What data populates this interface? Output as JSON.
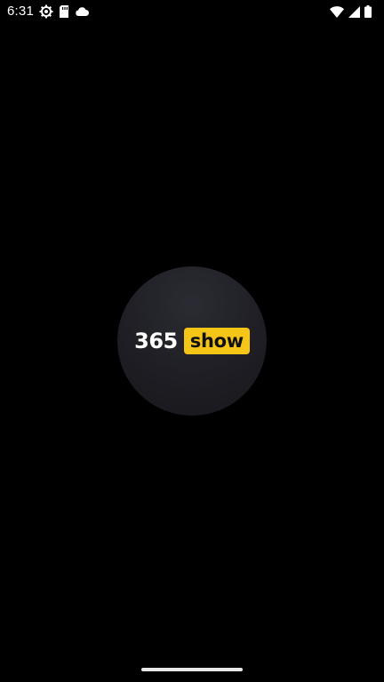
{
  "status_bar": {
    "time": "6:31",
    "left_icons": [
      "settings-icon",
      "sd-card-icon",
      "cloud-icon"
    ],
    "right_icons": [
      "wifi-icon",
      "cell-signal-icon",
      "battery-icon"
    ]
  },
  "splash": {
    "logo_number": "365",
    "logo_word": "show",
    "colors": {
      "background": "#000000",
      "circle": "#1e1e24",
      "badge": "#f5c518",
      "badge_text": "#111111",
      "number_text": "#ffffff"
    }
  },
  "navigation": {
    "handle": "gesture-nav-handle"
  }
}
